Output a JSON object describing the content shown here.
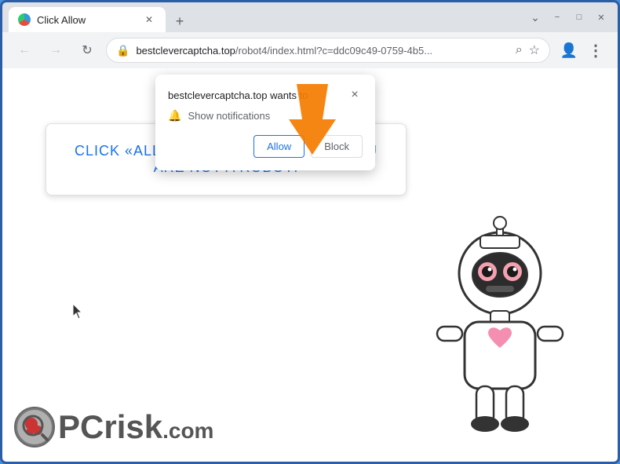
{
  "browser": {
    "tab": {
      "title": "Click Allow",
      "favicon": "globe-icon"
    },
    "new_tab_label": "+",
    "window_controls": {
      "minimize": "−",
      "maximize": "□",
      "close": "✕"
    },
    "nav": {
      "back_icon": "←",
      "forward_icon": "→",
      "refresh_icon": "↻",
      "url_domain": "bestclevercaptcha.top",
      "url_path": "/robot4/index.html?c=ddc09c49-0759-4b5...",
      "lock_icon": "🔒",
      "search_icon": "⌕",
      "bookmark_icon": "☆",
      "account_icon": "👤",
      "menu_icon": "⋮"
    }
  },
  "notification_popup": {
    "domain": "bestclevercaptcha.top wants to",
    "permission_text": "Show notifications",
    "allow_button": "Allow",
    "block_button": "Block",
    "close_icon": "×"
  },
  "page": {
    "captcha_text_colored": "CLICK «ALLOW» TO CONFIRM THAT ",
    "captcha_text_bold": "YOU ARE NOT A ROBOT!"
  },
  "logo": {
    "pc_text": "PC",
    "risk_text": "risk",
    "dot_com": ".com"
  },
  "colors": {
    "accent_blue": "#1a73e8",
    "arrow_orange": "#f57c00",
    "browser_border": "#3b78c4",
    "captcha_blue": "#1a73e8"
  }
}
